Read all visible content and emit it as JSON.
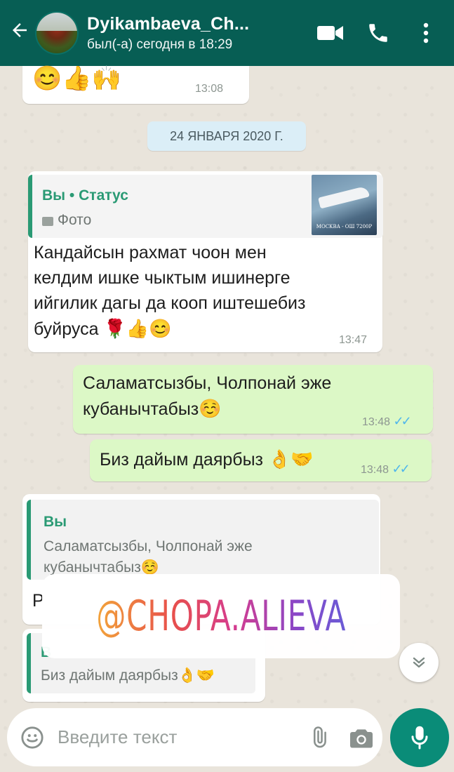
{
  "header": {
    "contact_name": "Dyikambaeva_Ch...",
    "last_seen": "был(-а) сегодня в 18:29"
  },
  "messages": {
    "m1": {
      "emojis": "😊👍🙌",
      "time": "13:08"
    },
    "date_divider": "24 ЯНВАРЯ 2020 Г.",
    "m2": {
      "quote_author": "Вы • Статус",
      "quote_text": "Фото",
      "thumb_caption": "МОСКВА - ОШ 7200Р",
      "line1": "Кандайсын рахмат чоон мен",
      "line2": "келдим ишке чыктым ишинерге",
      "line3": "ийгилик дагы да кооп иштешебиз",
      "line4": "буйруса",
      "line4_emojis": "🌹👍😊",
      "time": "13:47"
    },
    "m3": {
      "line1": "Саламатсызбы, Чолпонай эже",
      "line2": "кубанычтабыз",
      "line2_emoji": "☺️",
      "time": "13:48"
    },
    "m4": {
      "line1": "Биз дайым даярбыз",
      "emojis": "👌🤝",
      "time": "13:48"
    },
    "m5": {
      "quote_author": "Вы",
      "quote_line1": "Саламатсызбы, Чолпонай эже",
      "quote_line2": "кубанычтабыз☺️",
      "partial_letter": "Р"
    },
    "m6": {
      "quote_author": "В",
      "quote_text": "Биз дайым даярбыз👌🤝"
    }
  },
  "watermark": "@CHOPA.ALIEVA",
  "input": {
    "placeholder": "Введите текст"
  },
  "colors": {
    "header": "#075e54",
    "incoming": "#ffffff",
    "outgoing": "#dcf8c6",
    "accent": "#2a9a74",
    "ticks": "#4fb6ec",
    "mic": "#0a8c78"
  }
}
